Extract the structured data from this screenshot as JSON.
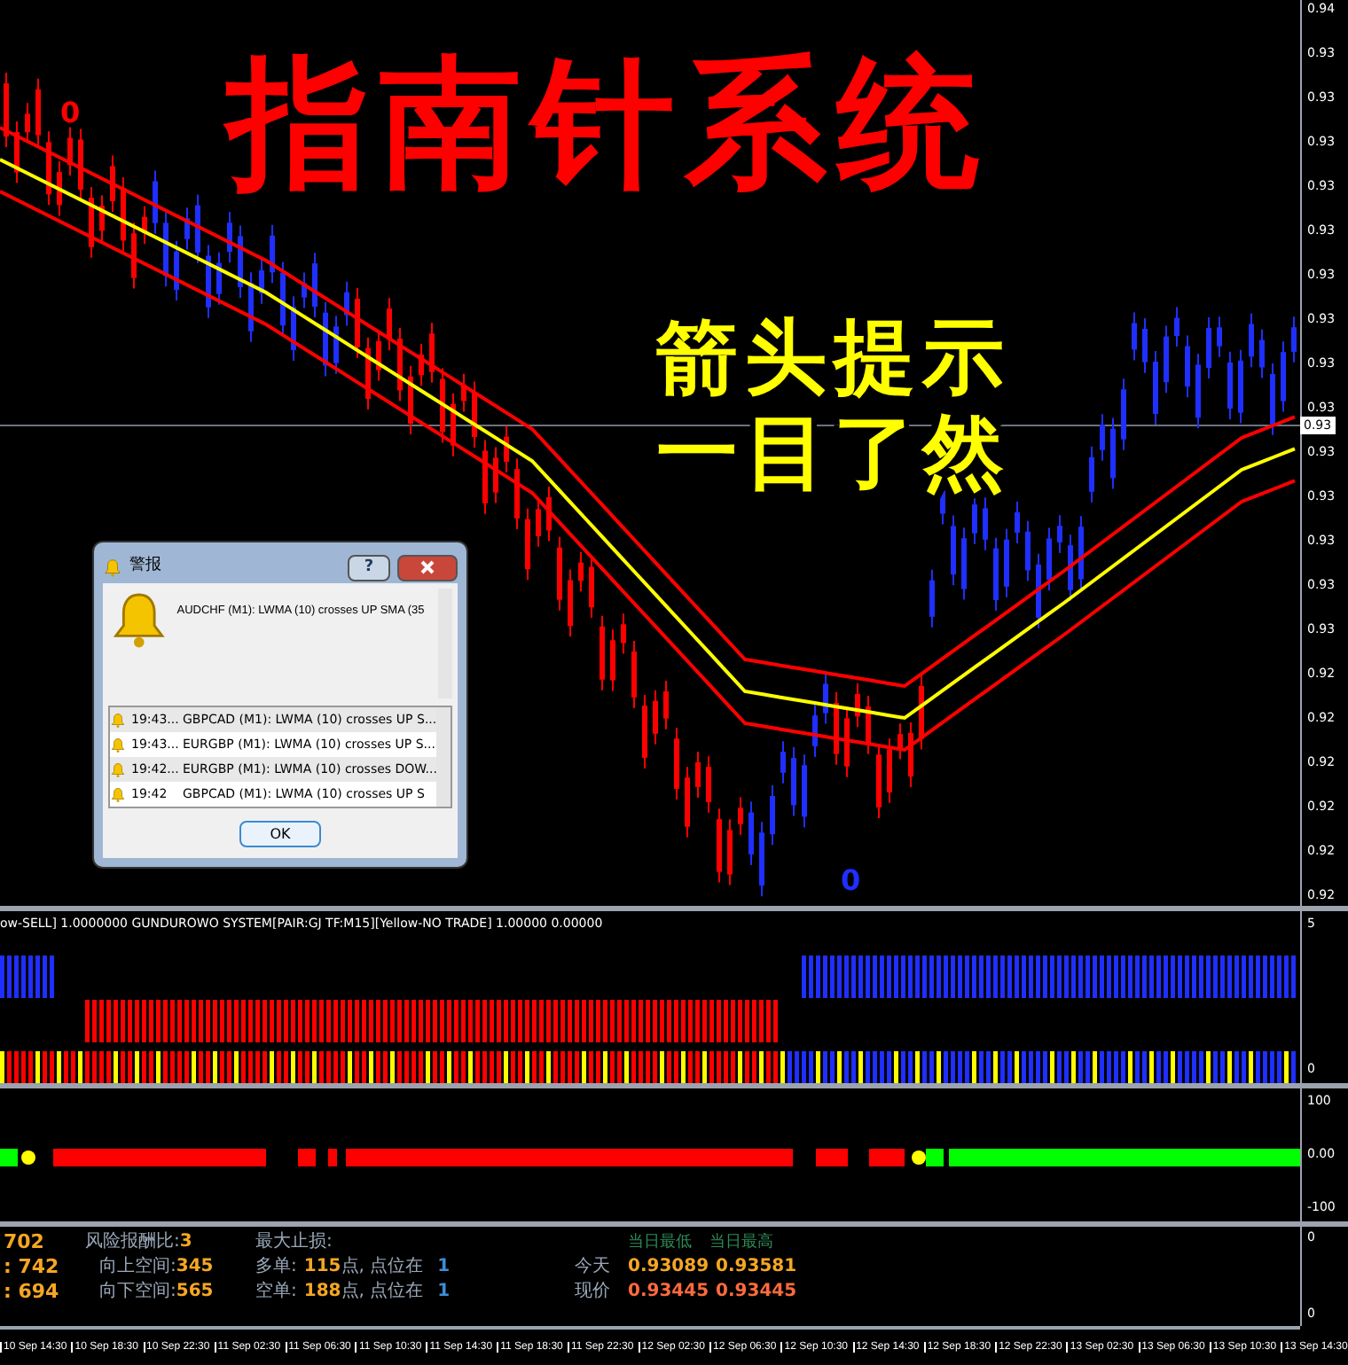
{
  "overlay": {
    "title": "指南针系统",
    "subtitle_lines": [
      "箭头提示",
      "一目了然"
    ],
    "arrow_marks": [
      "0",
      "0"
    ]
  },
  "price_axis": {
    "labels": [
      "0.94",
      "0.93",
      "0.93",
      "0.93",
      "0.93",
      "0.93",
      "0.93",
      "0.93",
      "0.93",
      "0.93",
      "0.93",
      "0.93",
      "0.93",
      "0.93",
      "0.93",
      "0.92",
      "0.92",
      "0.92",
      "0.92",
      "0.92",
      "0.92"
    ],
    "current_price": "0.93"
  },
  "alert_dialog": {
    "title": "警报",
    "help_button": "?",
    "message": "AUDCHF (M1):  LWMA (10) crosses UP SMA (35",
    "rows": [
      {
        "time": "19:43...",
        "text": "GBPCAD (M1):  LWMA (10) crosses UP S..."
      },
      {
        "time": "19:43...",
        "text": "EURGBP (M1):  LWMA (10) crosses UP S..."
      },
      {
        "time": "19:42...",
        "text": "EURGBP (M1):  LWMA (10) crosses DOW..."
      },
      {
        "time": "19:42",
        "text": "GBPCAD (M1):  LWMA (10) crosses UP S"
      }
    ],
    "ok_button": "OK"
  },
  "indicator_1": {
    "header": "ow-SELL] 1.0000000  GUNDUROWO SYSTEM[PAIR:GJ TF:M15][Yellow-NO TRADE] 1.00000 0.00000",
    "axis_labels": [
      "5",
      "0"
    ]
  },
  "indicator_2": {
    "axis_labels": [
      "100",
      "0.00",
      "-100"
    ]
  },
  "info_panel": {
    "axis_labels": [
      "0",
      "0"
    ],
    "left_values": [
      "702",
      ": 742",
      ": 694"
    ],
    "risk_reward": {
      "label": "风险报酬比:",
      "value": "3"
    },
    "up_space": {
      "label": "向上空间:",
      "value": "345"
    },
    "down_space": {
      "label": "向下空间:",
      "value": "565"
    },
    "max_stop": "最大止损:",
    "long": {
      "label": "多单:",
      "points": "115",
      "unit": "点, 点位在",
      "level": "1"
    },
    "short": {
      "label": "空单:",
      "points": "188",
      "unit": "点, 点位在",
      "level": "1"
    },
    "day_low_header": "当日最低",
    "day_high_header": "当日最高",
    "today": {
      "label": "今天",
      "low": "0.93089",
      "high": "0.93581"
    },
    "current": {
      "label": "现价",
      "low": "0.93445",
      "high": "0.93445"
    }
  },
  "time_axis": [
    "10 Sep 14:30",
    "10 Sep 18:30",
    "10 Sep 22:30",
    "11 Sep 02:30",
    "11 Sep 06:30",
    "11 Sep 10:30",
    "11 Sep 14:30",
    "11 Sep 18:30",
    "11 Sep 22:30",
    "12 Sep 02:30",
    "12 Sep 06:30",
    "12 Sep 10:30",
    "12 Sep 14:30",
    "12 Sep 18:30",
    "12 Sep 22:30",
    "13 Sep 02:30",
    "13 Sep 06:30",
    "13 Sep 10:30",
    "13 Sep 14:30"
  ]
}
